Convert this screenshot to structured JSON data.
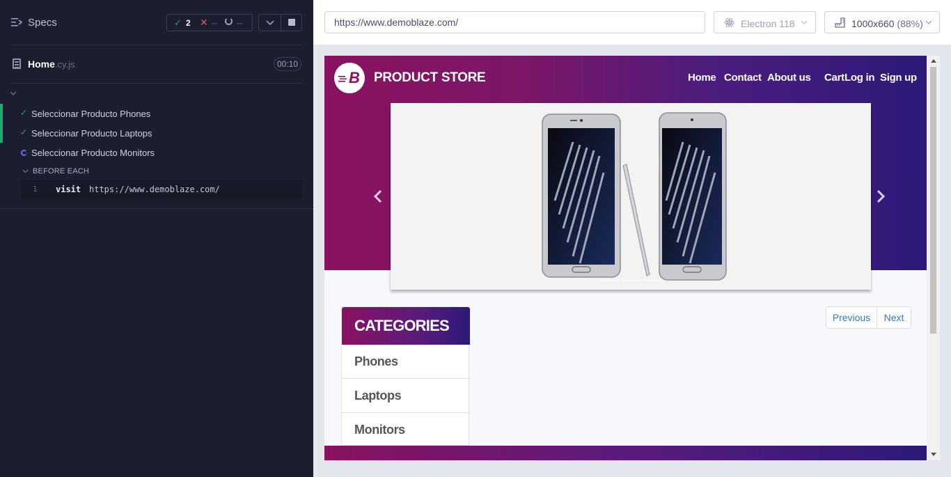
{
  "reporter": {
    "title": "Specs",
    "stats": {
      "passed": "2",
      "failed": "--",
      "pending": "--"
    },
    "spec": {
      "name": "Home",
      "ext": ".cy.js",
      "duration": "00:10"
    },
    "tests": [
      {
        "label": "Seleccionar Producto Phones",
        "state": "passed"
      },
      {
        "label": "Seleccionar Producto Laptops",
        "state": "passed"
      },
      {
        "label": "Seleccionar Producto Monitors",
        "state": "running"
      }
    ],
    "hook": {
      "label": "BEFORE EACH"
    },
    "command": {
      "number": "1",
      "name": "visit",
      "message": "https://www.demoblaze.com/"
    }
  },
  "aut": {
    "url": "https://www.demoblaze.com/",
    "browser": "Electron 118",
    "viewport": {
      "size": "1000x660",
      "scale": "(88%)"
    }
  },
  "site": {
    "brand": "PRODUCT STORE",
    "nav": [
      "Home",
      "Contact",
      "About us",
      "Cart",
      "Log in",
      "Sign up"
    ],
    "categories_title": "CATEGORIES",
    "categories": [
      "Phones",
      "Laptops",
      "Monitors"
    ],
    "pager": {
      "previous": "Previous",
      "next": "Next"
    }
  },
  "colors": {
    "reporter_bg": "#1b1e2e",
    "pass": "#1fa971",
    "fail": "#e45770",
    "brand_magenta": "#8a1260",
    "brand_indigo": "#2d1a78",
    "link": "#337ab7"
  }
}
